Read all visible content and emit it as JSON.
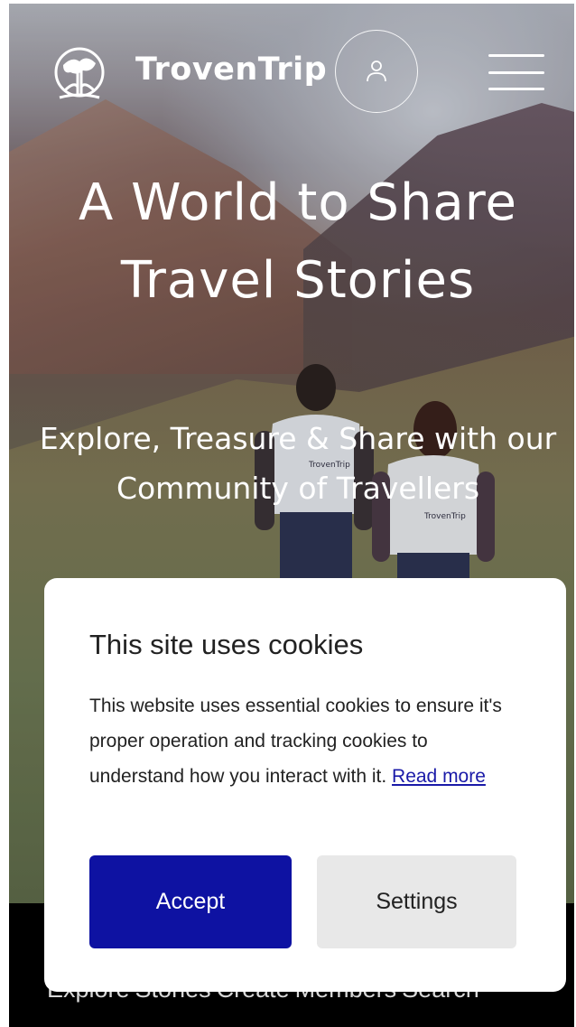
{
  "header": {
    "brand_name": "TrovenTrip",
    "logo_icon": "globe-tree-logo-icon",
    "account_icon": "user-icon",
    "menu_icon": "hamburger-menu-icon"
  },
  "hero": {
    "title": "A World to Share Travel Stories",
    "subtitle": "Explore, Treasure & Share with our Community of Travellers",
    "shirt_text": "TrovenTrip"
  },
  "cookie_dialog": {
    "title": "This site uses cookies",
    "body": "This website uses essential cookies to ensure it's proper operation and tracking cookies to understand how you interact with it.",
    "read_more_label": "Read more",
    "accept_label": "Accept",
    "settings_label": "Settings"
  },
  "bottom_nav": {
    "items": [
      {
        "label": "Explore"
      },
      {
        "label": "Stories"
      },
      {
        "label": "Create"
      },
      {
        "label": "Members"
      },
      {
        "label": "Search"
      }
    ]
  },
  "colors": {
    "accept_bg": "#0e12a2",
    "settings_bg": "#e8e8e8",
    "link": "#1a1aa8"
  }
}
